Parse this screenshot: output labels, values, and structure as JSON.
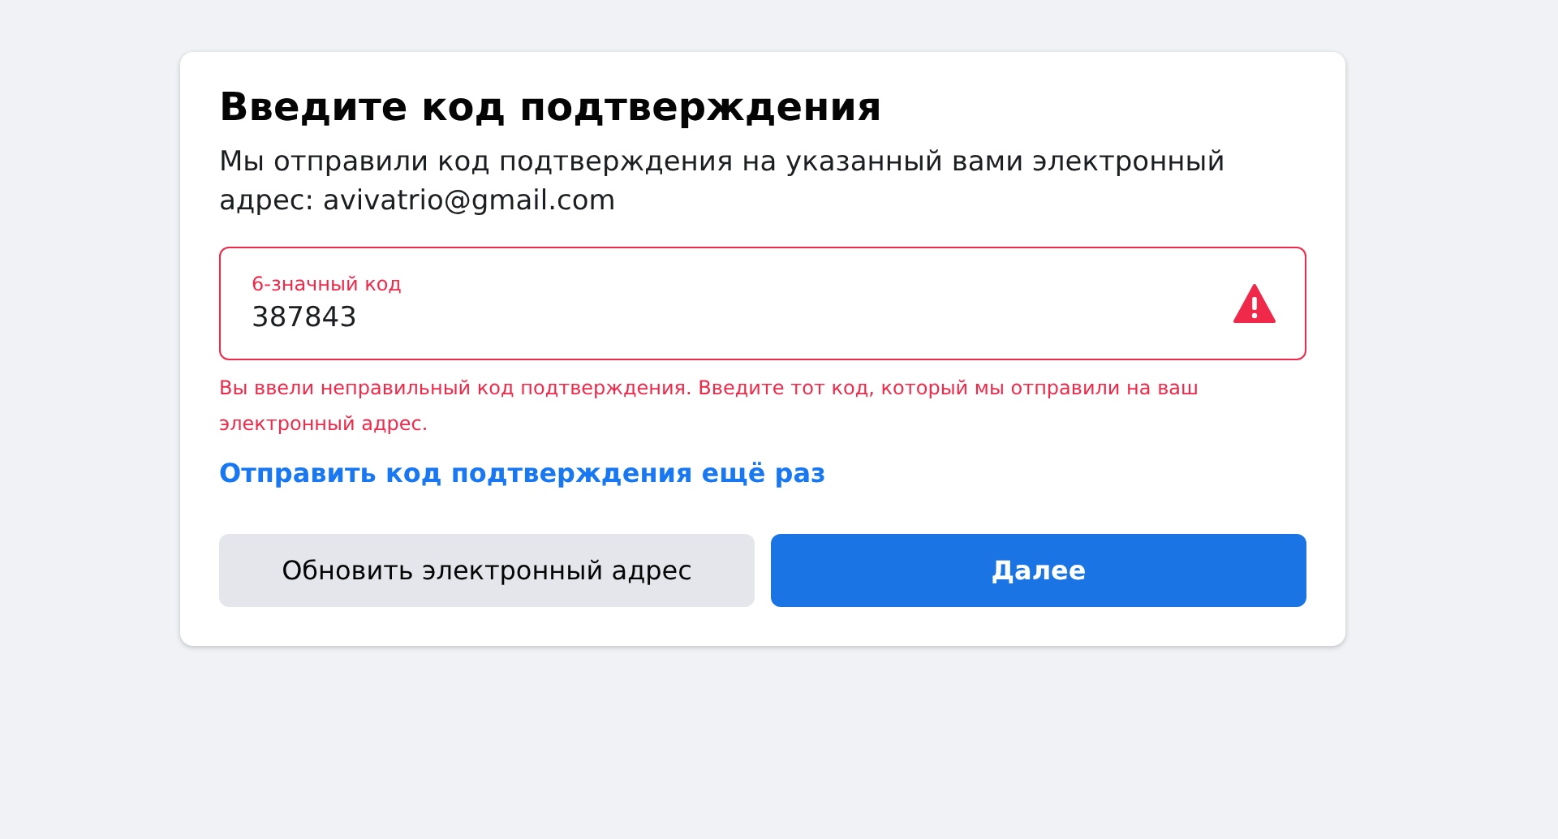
{
  "dialog": {
    "title": "Введите код подтверждения",
    "description": "Мы отправили код подтверждения на указанный вами электронный адрес: avivatrio@gmail.com",
    "code_field": {
      "label": "6-значный код",
      "value": "387843",
      "invalid": true
    },
    "error": "Вы ввели неправильный код подтверждения. Введите тот код, который мы отправили на ваш электронный адрес.",
    "resend_link": "Отправить код подтверждения ещё раз",
    "buttons": [
      {
        "label": "Обновить электронный адрес",
        "kind": "secondary"
      },
      {
        "label": "Далее",
        "kind": "primary"
      }
    ]
  }
}
